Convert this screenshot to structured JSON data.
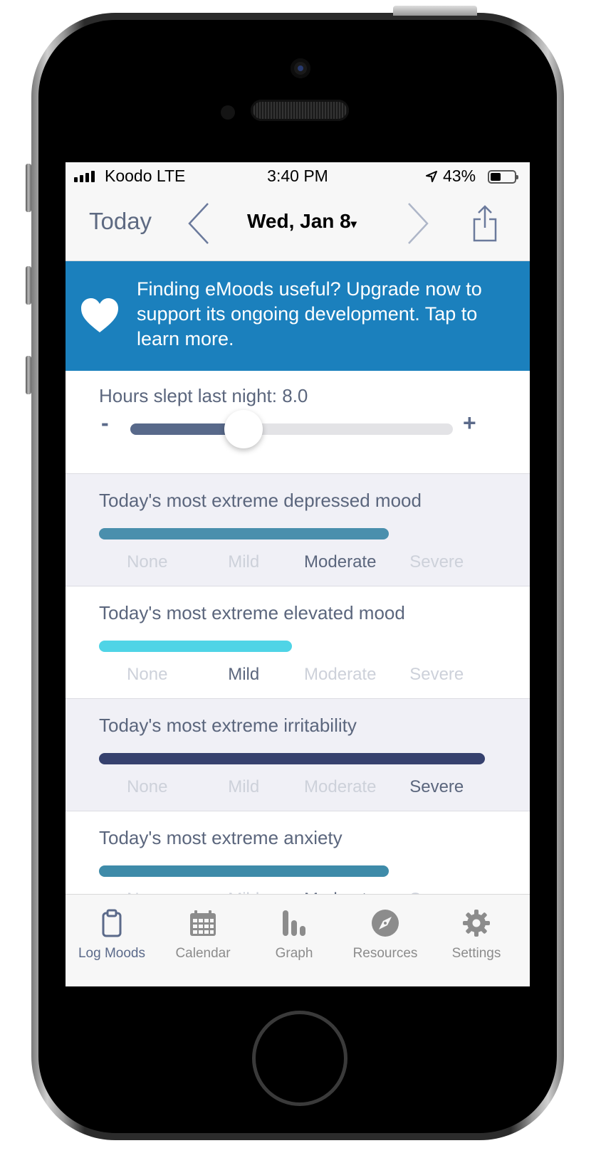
{
  "status_bar": {
    "carrier": "Koodo",
    "network": "LTE",
    "time": "3:40 PM",
    "battery_percent": "43%",
    "battery_level": 0.43
  },
  "nav": {
    "today_label": "Today",
    "date": "Wed, Jan 8",
    "caret": "▾"
  },
  "banner": {
    "text": "Finding eMoods useful? Upgrade now to support its ongoing development. Tap to learn more.",
    "background": "#1b80bd"
  },
  "sleep": {
    "label": "Hours slept last night:",
    "value": "8.0",
    "slider_fraction": 0.35,
    "minus_label": "-",
    "plus_label": "+"
  },
  "levels": [
    "None",
    "Mild",
    "Moderate",
    "Severe"
  ],
  "moods": [
    {
      "title": "Today's most extreme depressed mood",
      "selected_index": 2,
      "bar_color": "#4a8fad",
      "background": "#f0f0f6"
    },
    {
      "title": "Today's most extreme elevated mood",
      "selected_index": 1,
      "bar_color": "#4fd4e6",
      "background": "#ffffff"
    },
    {
      "title": "Today's most extreme irritability",
      "selected_index": 3,
      "bar_color": "#36416e",
      "background": "#f0f0f6"
    },
    {
      "title": "Today's most extreme anxiety",
      "selected_index": 2,
      "bar_color": "#3e8ba9",
      "background": "#ffffff"
    }
  ],
  "tabs": [
    {
      "label": "Log Moods",
      "icon": "clipboard-icon",
      "active": true
    },
    {
      "label": "Calendar",
      "icon": "calendar-icon",
      "active": false
    },
    {
      "label": "Graph",
      "icon": "bar-graph-icon",
      "active": false
    },
    {
      "label": "Resources",
      "icon": "compass-icon",
      "active": false
    },
    {
      "label": "Settings",
      "icon": "gear-icon",
      "active": false
    }
  ]
}
